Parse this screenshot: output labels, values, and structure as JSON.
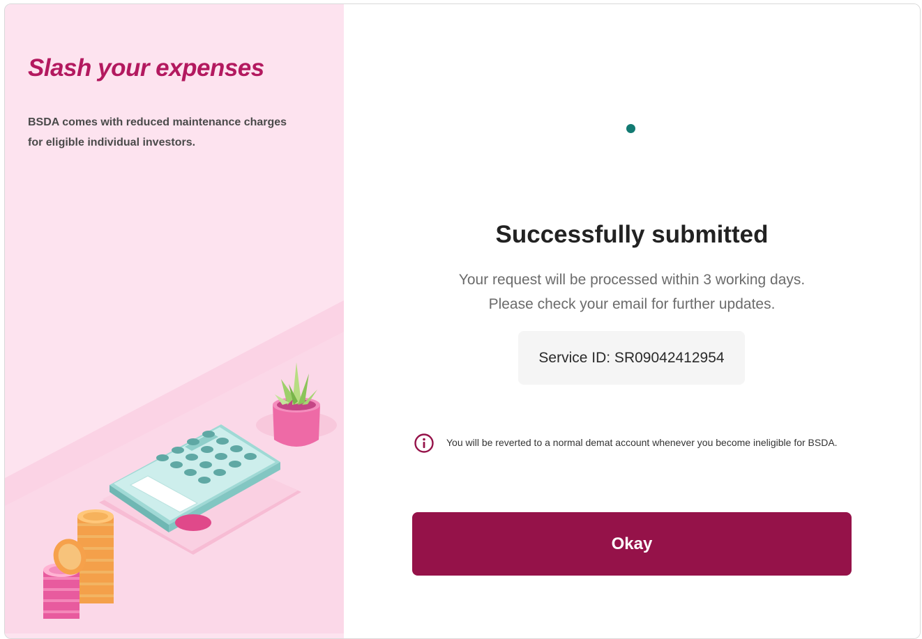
{
  "promo": {
    "title": "Slash your expenses",
    "description": "BSDA comes with reduced maintenance charges for eligible individual investors."
  },
  "status": {
    "title": "Successfully submitted",
    "message_line1": "Your request will be processed within 3 working days.",
    "message_line2": "Please check your email for further updates.",
    "service_id": "Service ID: SR09042412954"
  },
  "note": {
    "icon": "info-icon",
    "text": "You will be reverted to a normal demat account whenever you become ineligible for BSDA."
  },
  "actions": {
    "okay_label": "Okay"
  },
  "colors": {
    "brand": "#951249",
    "promo_title": "#b3195f",
    "promo_bg": "#fde3ef",
    "loader": "#127a72"
  }
}
